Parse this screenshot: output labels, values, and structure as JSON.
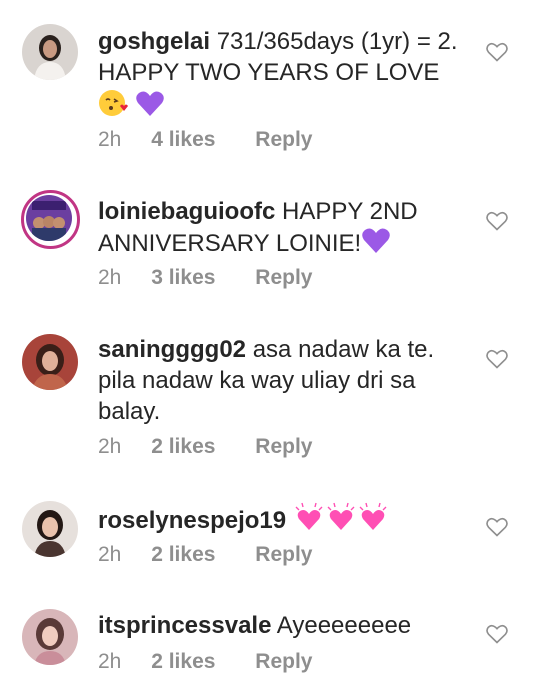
{
  "comments": [
    {
      "username": "goshgelai",
      "text": "731/365days (1yr) = 2. HAPPY TWO YEARS OF LOVE",
      "emojis": [
        "kissing-face-with-heart",
        "purple-heart"
      ],
      "time": "2h",
      "likes": "4 likes",
      "reply": "Reply"
    },
    {
      "username": "loiniebaguioofc",
      "text": "HAPPY 2ND ANNIVERSARY LOINIE!",
      "emojis": [
        "purple-heart"
      ],
      "time": "2h",
      "likes": "3 likes",
      "reply": "Reply"
    },
    {
      "username": "saningggg02",
      "text": "asa nadaw ka te. pila nadaw ka way uliay dri sa balay.",
      "time": "2h",
      "likes": "2 likes",
      "reply": "Reply"
    },
    {
      "username": "roselynespejo19",
      "text": "",
      "emojis": [
        "growing-heart",
        "growing-heart",
        "growing-heart"
      ],
      "time": "2h",
      "likes": "2 likes",
      "reply": "Reply"
    },
    {
      "username": "itsprincessvale",
      "text": "Ayeeeeeeee",
      "time": "2h",
      "likes": "2 likes",
      "reply": "Reply"
    }
  ],
  "colors": {
    "text": "#262626",
    "meta": "#8e8e8e",
    "story_ring": "#c13584",
    "purple_heart": "#9b59e6",
    "pink_heart": "#ff4fb4"
  }
}
